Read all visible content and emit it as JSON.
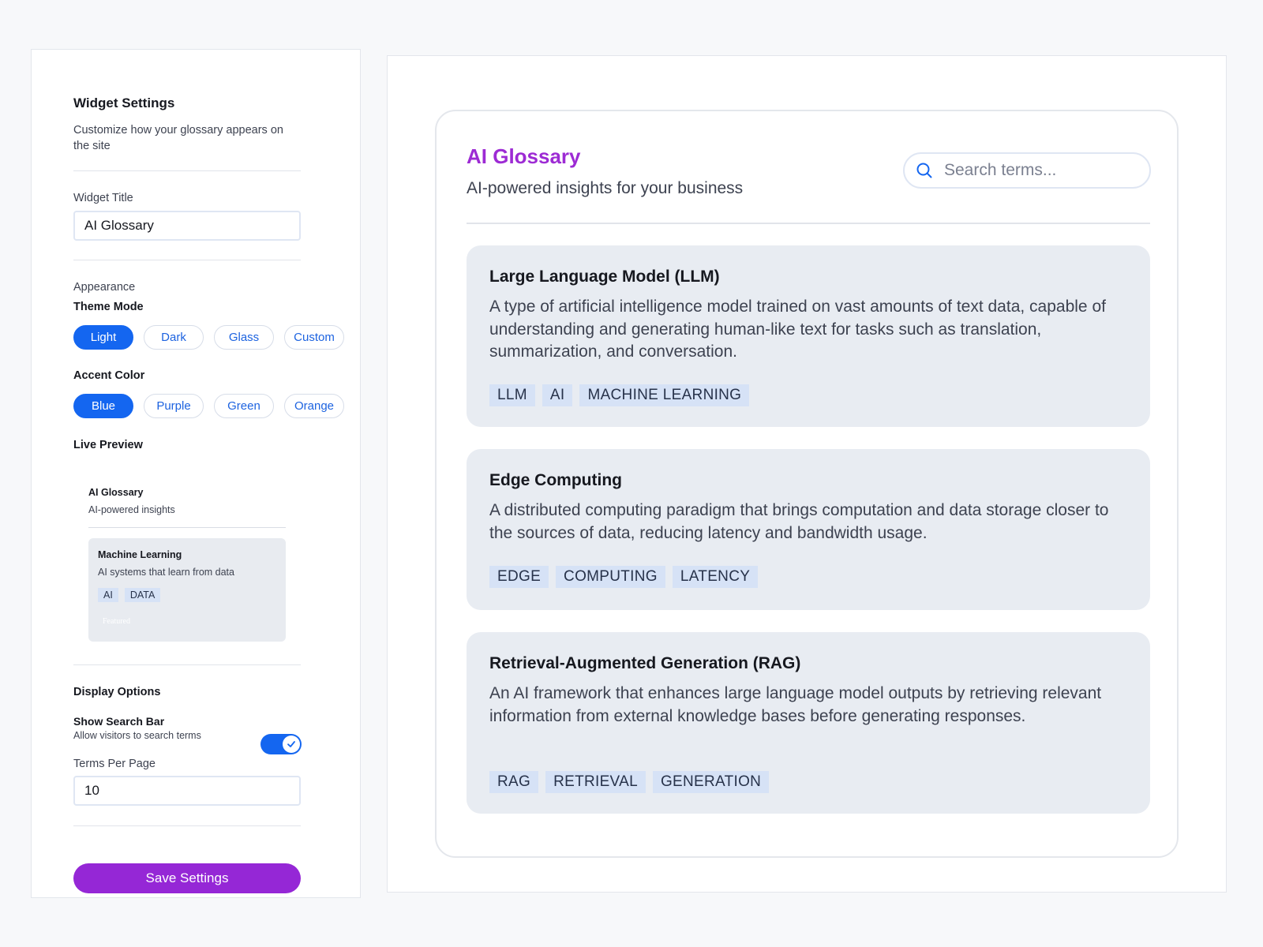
{
  "settings": {
    "title": "Widget Settings",
    "description": "Customize how your glossary appears on the site",
    "widget_title_label": "Widget Title",
    "widget_title_value": "AI Glossary",
    "appearance_label": "Appearance",
    "theme_mode_label": "Theme Mode",
    "theme_modes": [
      "Light",
      "Dark",
      "Glass",
      "Custom"
    ],
    "theme_mode_selected": "Light",
    "accent_color_label": "Accent Color",
    "accent_colors": [
      "Blue",
      "Purple",
      "Green",
      "Orange"
    ],
    "accent_color_selected": "Blue",
    "live_preview_label": "Live Preview",
    "live_preview": {
      "title": "AI Glossary",
      "subtitle": "AI-powered insights",
      "card_title": "Machine Learning",
      "card_description": "AI systems that learn from data",
      "card_tags": [
        "AI",
        "DATA"
      ],
      "featured_label": "Featured"
    },
    "display_options_label": "Display Options",
    "show_search_label": "Show Search Bar",
    "show_search_hint": "Allow visitors to search terms",
    "show_search_enabled": true,
    "terms_per_page_label": "Terms Per Page",
    "terms_per_page_value": "10",
    "save_label": "Save Settings"
  },
  "widget": {
    "title": "AI Glossary",
    "subtitle": "AI-powered insights for your business",
    "search_placeholder": "Search terms...",
    "terms": [
      {
        "title": "Large Language Model (LLM)",
        "description": "A type of artificial intelligence model trained on vast amounts of text data, capable of understanding and generating human-like text for tasks such as translation, summarization, and conversation.",
        "tags": [
          "LLM",
          "AI",
          "MACHINE LEARNING"
        ]
      },
      {
        "title": "Edge Computing",
        "description": "A distributed computing paradigm that brings computation and data storage closer to the sources of data, reducing latency and bandwidth usage.",
        "tags": [
          "EDGE",
          "COMPUTING",
          "LATENCY"
        ]
      },
      {
        "title": "Retrieval-Augmented Generation (RAG)",
        "description": "An AI framework that enhances large language model outputs by retrieving relevant information from external knowledge bases before generating responses.",
        "tags": [
          "RAG",
          "RETRIEVAL",
          "GENERATION"
        ]
      }
    ]
  },
  "colors": {
    "primary_blue": "#1466f0",
    "accent_purple": "#9527d6",
    "title_purple": "#9d2bd4",
    "card_bg": "#e8ecf2",
    "tag_bg": "#d6e2f6"
  },
  "icons": [
    "search-icon",
    "check-icon"
  ]
}
